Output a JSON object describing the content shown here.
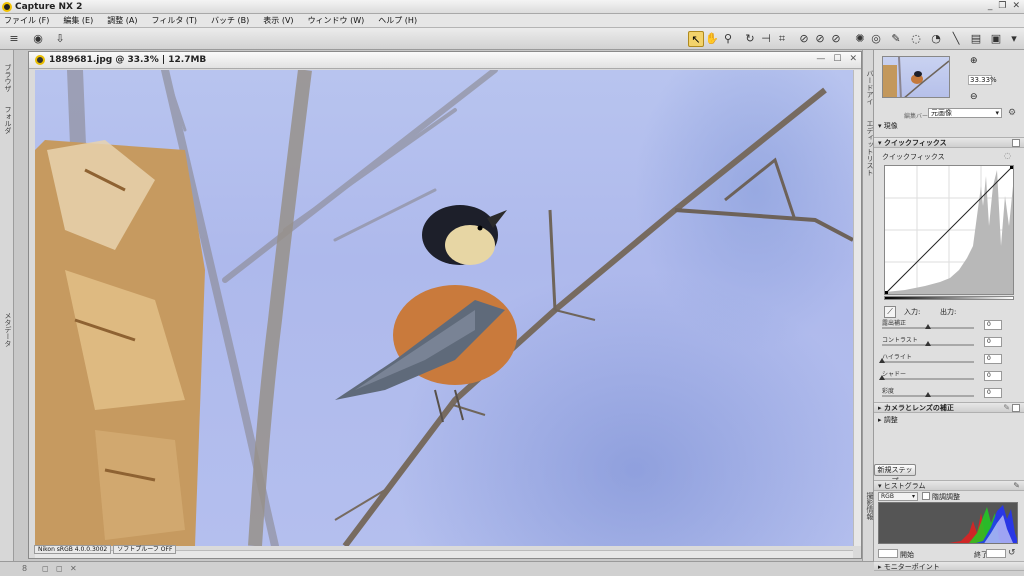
{
  "app": {
    "title": "Capture NX 2"
  },
  "window_controls": {
    "minimize": "_",
    "restore": "❐",
    "close": "✕"
  },
  "menu": [
    "ファイル (F)",
    "編集 (E)",
    "調整 (A)",
    "フィルタ (T)",
    "バッチ (B)",
    "表示 (V)",
    "ウィンドウ (W)",
    "ヘルプ (H)"
  ],
  "left_panel_labels": {
    "browser": "ブラウザ",
    "folder": "フォルダ",
    "metadata": "メタデータ"
  },
  "document": {
    "title": "1889681.jpg @ 33.3% | 12.7MB",
    "controls": {
      "minimize": "—",
      "restore": "☐",
      "close": "✕"
    },
    "status": [
      "Nikon sRGB 4.0.0.3002",
      "ソフトプルーフ OFF"
    ]
  },
  "right_panel": {
    "strip_labels": {
      "birdseye": "バードアイ",
      "edit_list": "エディットリスト",
      "photo_info": "撮影情報"
    },
    "zoom": {
      "value": "33.33",
      "unit": "%"
    },
    "version": {
      "label": "編集バージョン:",
      "value": "元画像"
    },
    "sections": {
      "develop": "現像",
      "quickfix": "クイックフィックス",
      "quickfix_sub": "クイックフィックス",
      "camera_lens": "カメラとレンズの補正",
      "adjust": "調整",
      "new_step": "新規ステップ",
      "histogram": "ヒストグラム",
      "monitor_point": "モニターポイント"
    },
    "io": {
      "input": "入力:",
      "output": "出力:"
    },
    "sliders": [
      {
        "label": "露出補正",
        "value": "0",
        "pos": 0.5
      },
      {
        "label": "コントラスト",
        "value": "0",
        "pos": 0.5
      },
      {
        "label": "ハイライト",
        "value": "0",
        "pos": 0.0
      },
      {
        "label": "シャドー",
        "value": "0",
        "pos": 0.0
      },
      {
        "label": "彩度",
        "value": "0",
        "pos": 0.5
      }
    ],
    "histogram": {
      "channel": "RGB",
      "option": "階調調整",
      "start": "開始",
      "end": "終了"
    }
  },
  "bottom_strip": {
    "label": "8"
  }
}
